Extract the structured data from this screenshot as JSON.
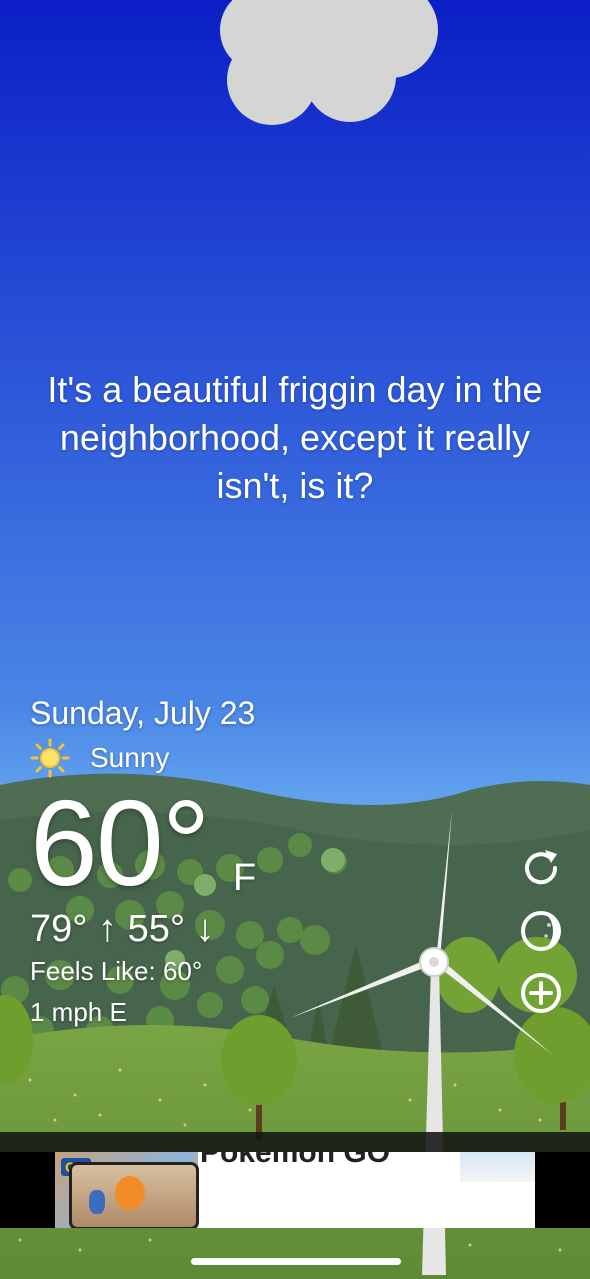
{
  "quote": "It's a beautiful friggin day in the neighborhood, except it really isn't, is it?",
  "weather": {
    "date": "Sunday, July 23",
    "condition": "Sunny",
    "condition_icon": "sun-icon",
    "temperature": "60°",
    "unit": "F",
    "high_low": "79° ↑ 55° ↓",
    "feels_like": "Feels Like: 60°",
    "wind": "1 mph E"
  },
  "actions": {
    "refresh_icon": "refresh-icon",
    "moon_icon": "moon-phase-icon",
    "add_icon": "add-location-icon"
  },
  "ad": {
    "title": "Pokémon GO",
    "image_caption": "GO"
  },
  "colors": {
    "sky_top": "#0a20c8",
    "sky_bottom": "#62a3ef",
    "grass": "#6f9a3c",
    "hill": "#4d6b4d"
  }
}
